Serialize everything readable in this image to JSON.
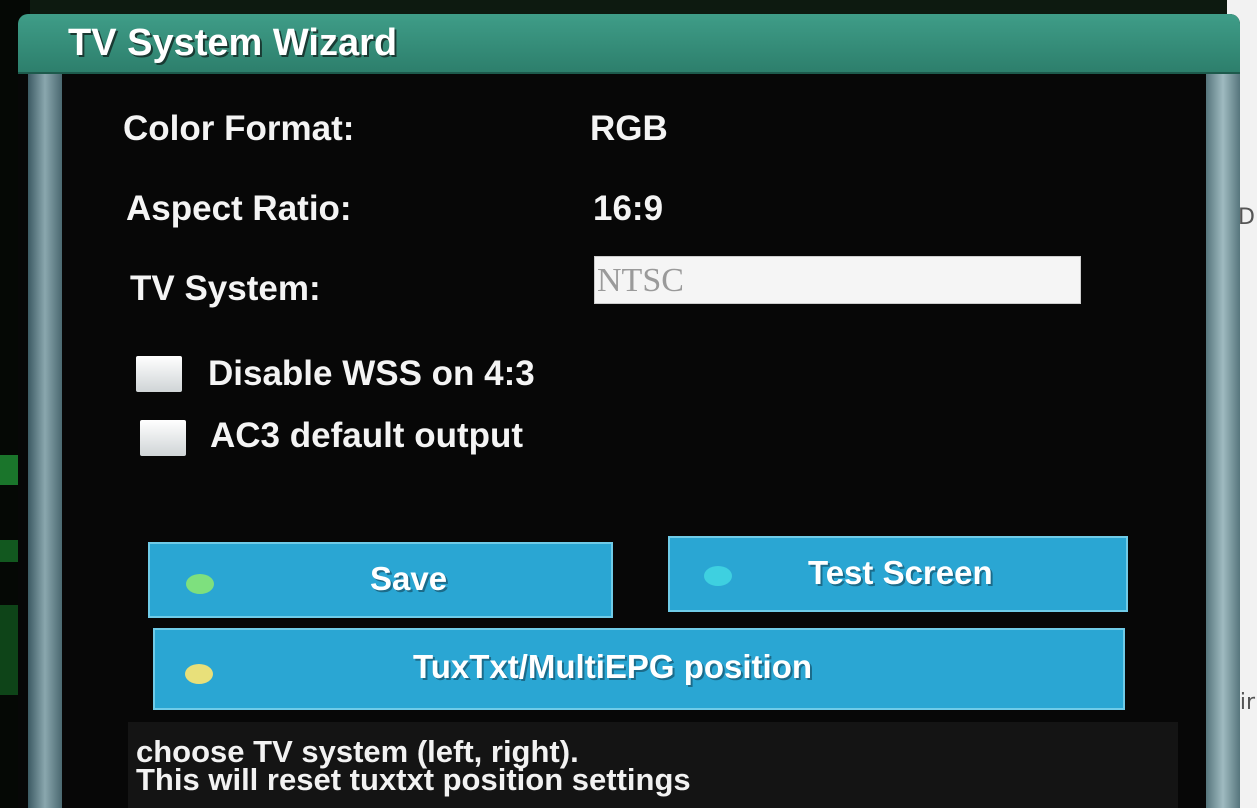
{
  "dialog": {
    "title": "TV System Wizard"
  },
  "fields": {
    "color_format_label": "Color Format:",
    "color_format_value": "RGB",
    "aspect_ratio_label": "Aspect Ratio:",
    "aspect_ratio_value": "16:9",
    "tv_system_label": "TV System:",
    "tv_system_value": "NTSC"
  },
  "options": {
    "disable_wss_label": "Disable WSS on 4:3",
    "ac3_label": "AC3 default output"
  },
  "buttons": {
    "save_label": "Save",
    "test_screen_label": "Test Screen",
    "tuxtxt_label": "TuxTxt/MultiEPG position"
  },
  "colors": {
    "save_dot": "#7ee07e",
    "test_screen_dot": "#3ed0e0",
    "tuxtxt_dot": "#e8e07a",
    "button_bg": "#2aa6d3",
    "title_bar": "#2d7f6c"
  },
  "hint": {
    "line1": "choose TV system (left, right).",
    "line2": "This will reset tuxtxt position settings"
  },
  "background": {
    "right_text_1": "-ir",
    "right_text_2": "D"
  }
}
